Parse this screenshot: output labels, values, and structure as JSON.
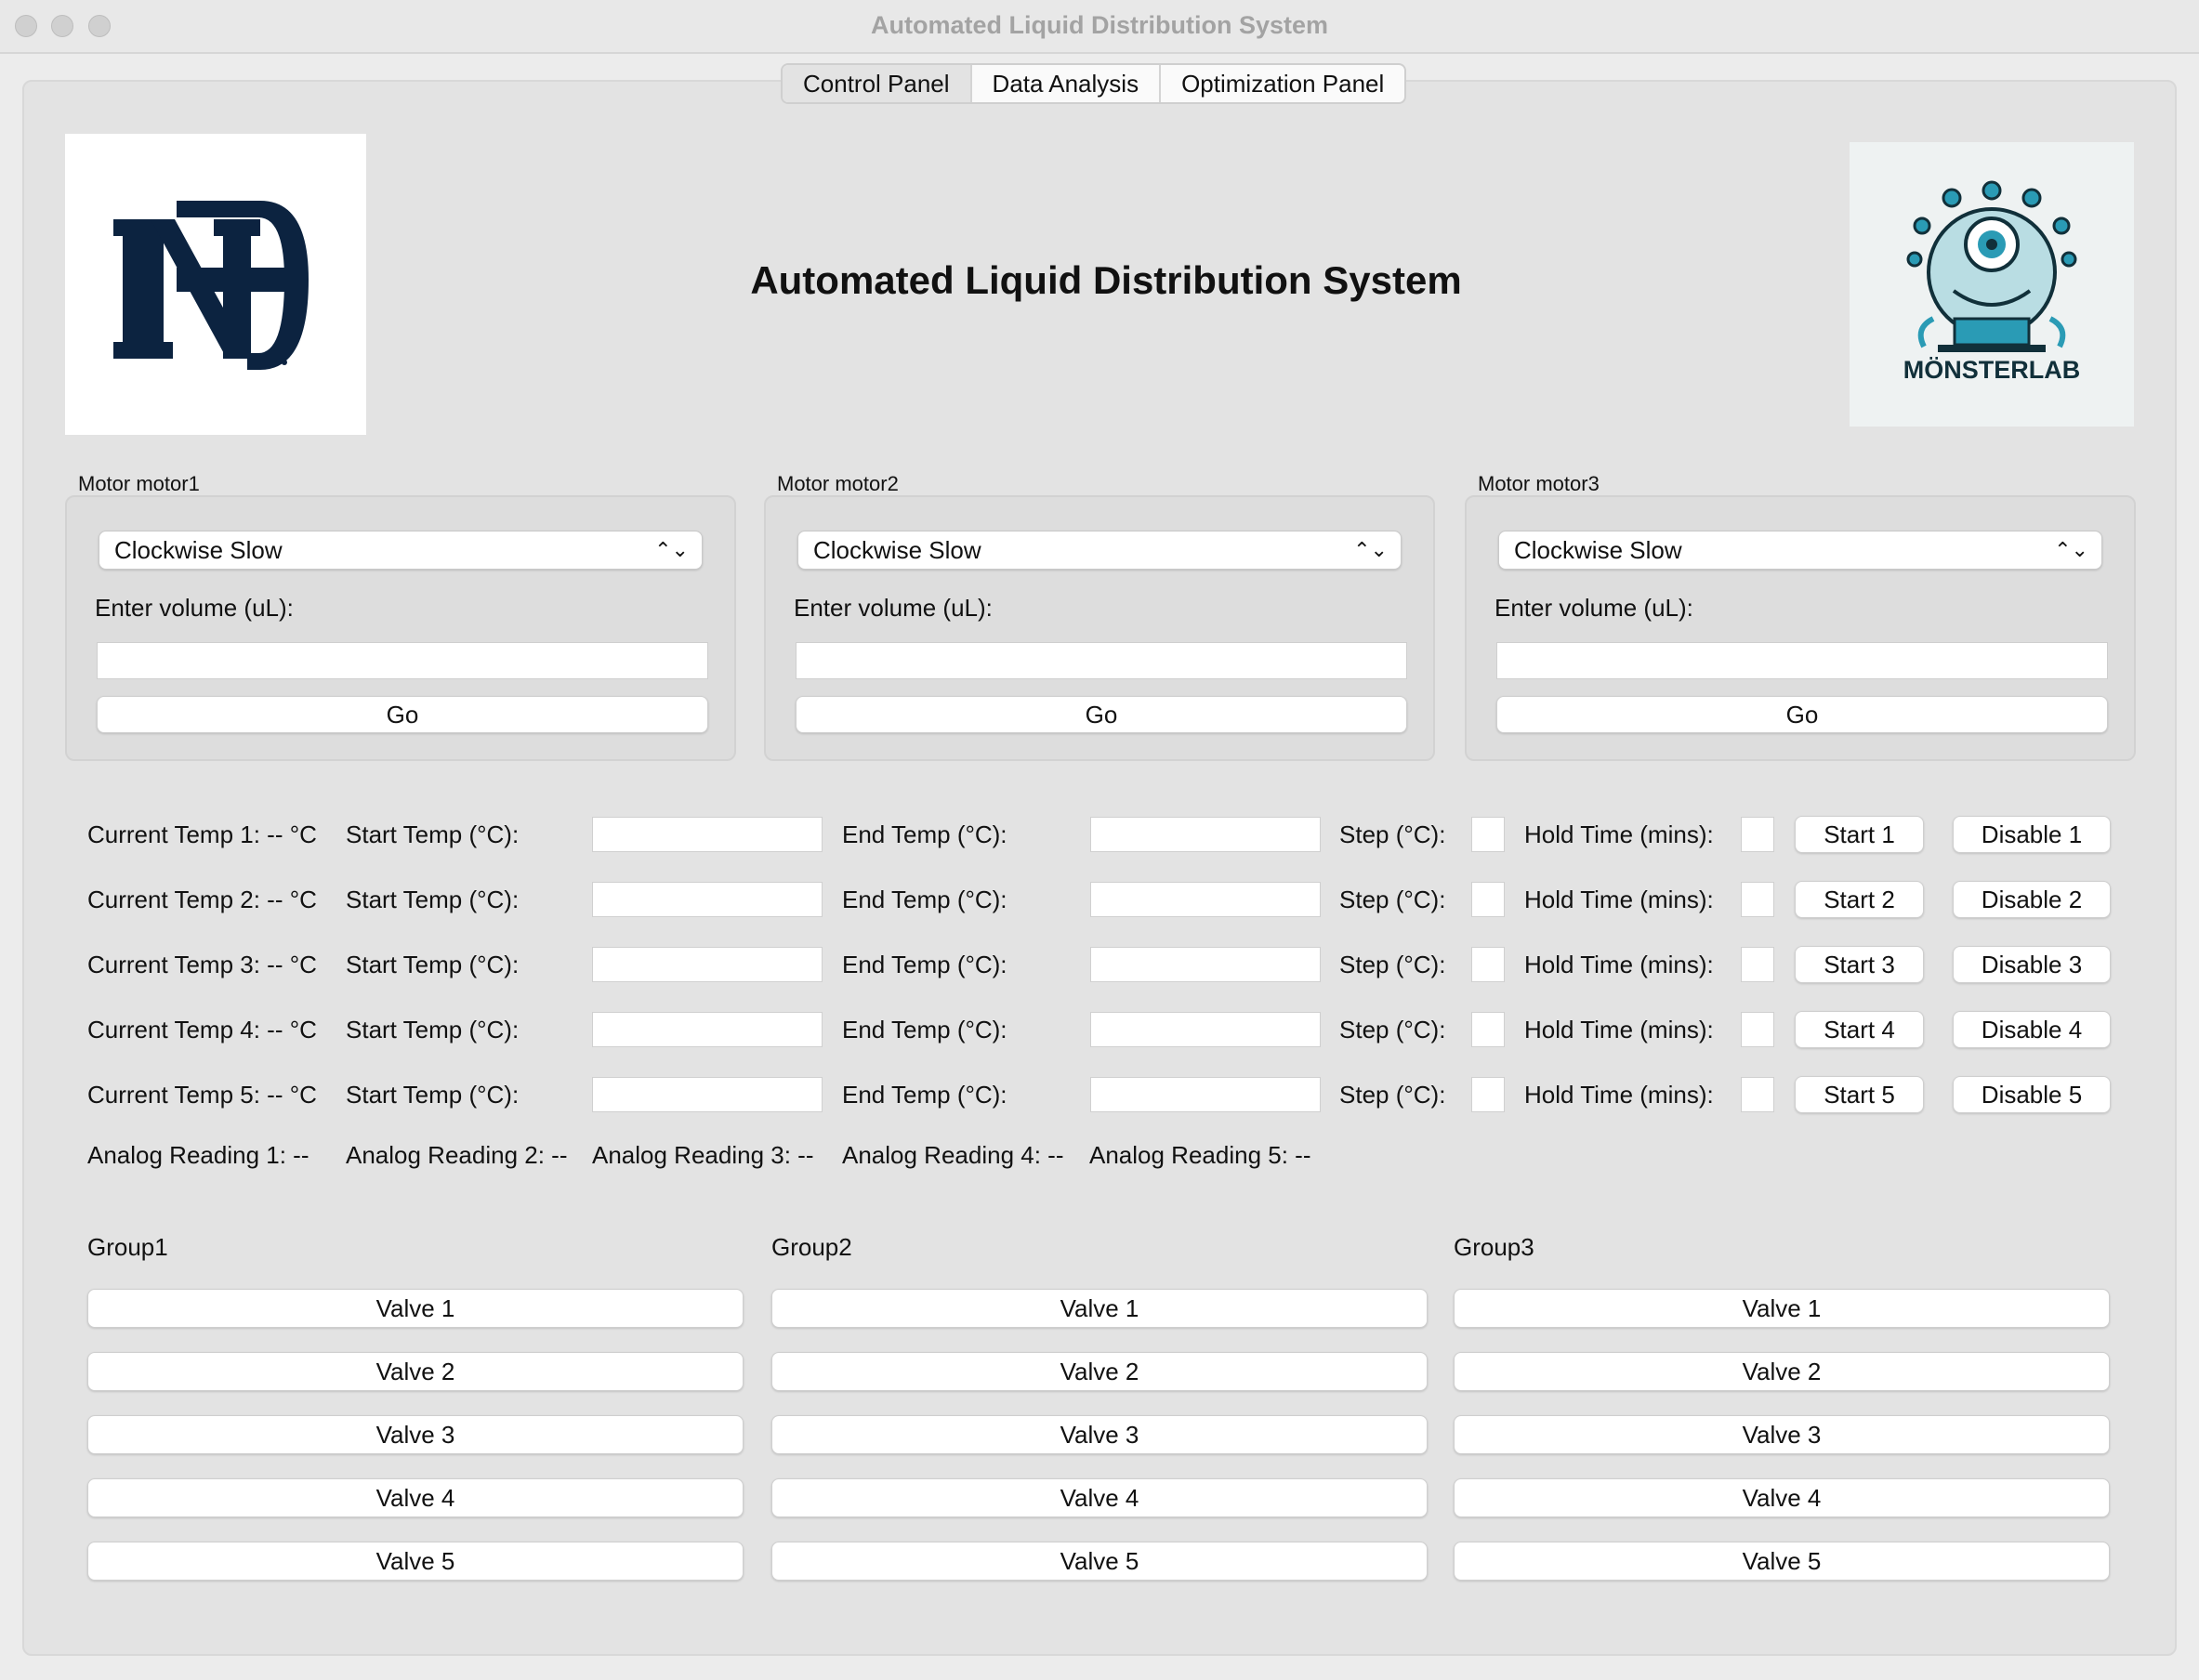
{
  "window": {
    "title": "Automated Liquid Distribution System"
  },
  "tabs": [
    "Control Panel",
    "Data Analysis",
    "Optimization Panel"
  ],
  "active_tab": "Control Panel",
  "heading": "Automated Liquid Distribution System",
  "logos": {
    "left_text": "ND",
    "right_text": "MÖNSTERLAB"
  },
  "motors": [
    {
      "label": "Motor motor1",
      "direction": "Clockwise Slow",
      "volume_label": "Enter volume (uL):",
      "volume_value": "",
      "go_label": "Go"
    },
    {
      "label": "Motor motor2",
      "direction": "Clockwise Slow",
      "volume_label": "Enter volume (uL):",
      "volume_value": "",
      "go_label": "Go"
    },
    {
      "label": "Motor motor3",
      "direction": "Clockwise Slow",
      "volume_label": "Enter volume (uL):",
      "volume_value": "",
      "go_label": "Go"
    }
  ],
  "temps": [
    {
      "current": "Current Temp 1: -- °C",
      "start_label": "Start Temp (°C):",
      "end_label": "End Temp (°C):",
      "step_label": "Step (°C):",
      "hold_label": "Hold Time (mins):",
      "start_btn": "Start 1",
      "disable_btn": "Disable 1"
    },
    {
      "current": "Current Temp 2: -- °C",
      "start_label": "Start Temp (°C):",
      "end_label": "End Temp (°C):",
      "step_label": "Step (°C):",
      "hold_label": "Hold Time (mins):",
      "start_btn": "Start 2",
      "disable_btn": "Disable 2"
    },
    {
      "current": "Current Temp 3: -- °C",
      "start_label": "Start Temp (°C):",
      "end_label": "End Temp (°C):",
      "step_label": "Step (°C):",
      "hold_label": "Hold Time (mins):",
      "start_btn": "Start 3",
      "disable_btn": "Disable 3"
    },
    {
      "current": "Current Temp 4: -- °C",
      "start_label": "Start Temp (°C):",
      "end_label": "End Temp (°C):",
      "step_label": "Step (°C):",
      "hold_label": "Hold Time (mins):",
      "start_btn": "Start 4",
      "disable_btn": "Disable 4"
    },
    {
      "current": "Current Temp 5: -- °C",
      "start_label": "Start Temp (°C):",
      "end_label": "End Temp (°C):",
      "step_label": "Step (°C):",
      "hold_label": "Hold Time (mins):",
      "start_btn": "Start 5",
      "disable_btn": "Disable 5"
    }
  ],
  "analog": [
    "Analog Reading 1: --",
    "Analog Reading 2: --",
    "Analog Reading 3: --",
    "Analog Reading 4: --",
    "Analog Reading 5: --"
  ],
  "groups": [
    {
      "name": "Group1",
      "valves": [
        "Valve 1",
        "Valve 2",
        "Valve 3",
        "Valve 4",
        "Valve 5"
      ]
    },
    {
      "name": "Group2",
      "valves": [
        "Valve 1",
        "Valve 2",
        "Valve 3",
        "Valve 4",
        "Valve 5"
      ]
    },
    {
      "name": "Group3",
      "valves": [
        "Valve 1",
        "Valve 2",
        "Valve 3",
        "Valve 4",
        "Valve 5"
      ]
    }
  ],
  "colors": {
    "nd_navy": "#0c2340",
    "monster_teal": "#2a9bb5",
    "monster_dark": "#11303a"
  }
}
